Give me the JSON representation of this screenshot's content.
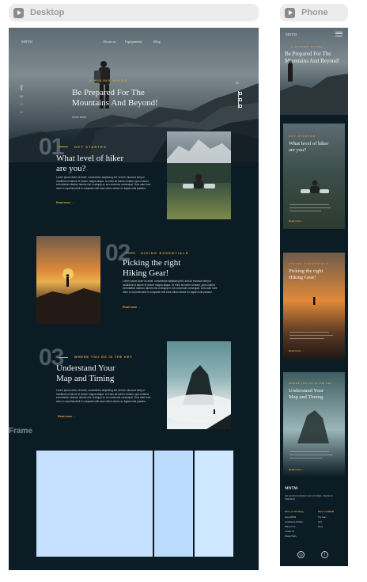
{
  "frames": {
    "desktop": "Desktop",
    "phone": "Phone",
    "frame": "Frame"
  },
  "desktop": {
    "nav": {
      "logo": "MNTM",
      "links": [
        "About us",
        "Equipments",
        "Blog"
      ]
    },
    "hero": {
      "kicker": "A HIKING GUIDE",
      "title_line1": "Be Prepared For The",
      "title_line2": "Mountains And Beyond!",
      "cta": "Scroll down",
      "side_nav": [
        "Start",
        "01",
        "02",
        "03"
      ],
      "slide_no": "01"
    },
    "sections": [
      {
        "number": "01",
        "tag": "GET STARTED",
        "title_line1": "What level of hiker",
        "title_line2": "are you?",
        "body": "Lorem ipsum dolor sit amet, consectetur adipiscing elit, sed do eiusmod tempor incididunt ut labore et dolore magna aliqua. Ut enim ad minim veniam, quis nostrud exercitation ullamco laboris nisi ut aliquip ex ea commodo consequat. Duis aute irure dolor in reprehenderit in voluptate velit esse cillum dolore eu fugiat nulla pariatur.",
        "read": "Read more  →"
      },
      {
        "number": "02",
        "tag": "HIKING ESSENTIALS",
        "title_line1": "Picking the right",
        "title_line2": "Hiking Gear!",
        "body": "Lorem ipsum dolor sit amet, consectetur adipiscing elit, sed do eiusmod tempor incididunt ut labore et dolore magna aliqua. Ut enim ad minim veniam, quis nostrud exercitation ullamco laboris nisi ut aliquip ex ea commodo consequat. Duis aute irure dolor in reprehenderit in voluptate velit esse cillum dolore eu fugiat nulla pariatur.",
        "read": "Read more  →"
      },
      {
        "number": "03",
        "tag": "WHERE YOU GO IS THE KEY",
        "title_line1": "Understand Your",
        "title_line2": "Map and Timing",
        "body": "Lorem ipsum dolor sit amet, consectetur adipiscing elit, sed do eiusmod tempor incididunt ut labore et dolore magna aliqua. Ut enim ad minim veniam, quis nostrud exercitation ullamco laboris nisi ut aliquip ex ea commodo consequat. Duis aute irure dolor in reprehenderit in voluptate velit esse cillum dolore eu fugiat nulla pariatur.",
        "read": "Read more  →"
      }
    ]
  },
  "phone": {
    "logo": "MNTM",
    "hero": {
      "kicker": "A HIKING GUIDE",
      "title_line1": "Be Prepared For The",
      "title_line2": "Mountains And Beyond!"
    },
    "cards": [
      {
        "tag": "GET STARTED",
        "title_line1": "What level of hiker",
        "title_line2": "are you?",
        "read": "Read more  →"
      },
      {
        "tag": "HIKING ESSENTIALS",
        "title_line1": "Picking the right",
        "title_line2": "Hiking Gear!",
        "read": "Read more  →"
      },
      {
        "tag": "WHERE YOU GO IS THE KEY",
        "title_line1": "Understand Your",
        "title_line2": "Map and Timing",
        "read": "Read more  →"
      }
    ],
    "footer": {
      "logo": "MNTM",
      "text": "Get out there & discover your next slope, mountain & destination!",
      "col1_title": "More on The Blog",
      "col1_items": [
        "About MNTM",
        "Contributors & Writers",
        "Write For Us",
        "Contact Us",
        "Privacy Policy"
      ],
      "col2_title": "More on MNTM",
      "col2_items": [
        "The Team",
        "Jobs",
        "Press"
      ]
    }
  },
  "colors": {
    "bg": "#0c1c24",
    "accent": "#d9a441",
    "blue1": "#c6e1ff",
    "blue2": "#bcdcfd",
    "blue3": "#cfe8ff"
  }
}
